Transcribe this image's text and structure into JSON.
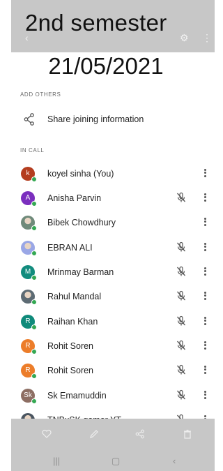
{
  "overlay": {
    "title": "2nd semester",
    "date": "21/05/2021"
  },
  "sections": {
    "add_others": "ADD OTHERS",
    "in_call": "IN CALL"
  },
  "share": {
    "label": "Share joining information"
  },
  "participants": [
    {
      "name": "koyel sinha (You)",
      "initial": "k",
      "color": "#b43d1f",
      "muted": false,
      "photo": false
    },
    {
      "name": "Anisha Parvin",
      "initial": "A",
      "color": "#7b2fbe",
      "muted": true,
      "photo": false
    },
    {
      "name": "Bibek Chowdhury",
      "initial": "",
      "color": "#6f8a7a",
      "muted": false,
      "photo": true
    },
    {
      "name": "EBRAN ALI",
      "initial": "",
      "color": "#9aa7e6",
      "muted": true,
      "photo": true
    },
    {
      "name": "Mrinmay Barman",
      "initial": "M",
      "color": "#128c7e",
      "muted": true,
      "photo": false
    },
    {
      "name": "Rahul Mandal",
      "initial": "",
      "color": "#5d6b74",
      "muted": true,
      "photo": true
    },
    {
      "name": "Raihan Khan",
      "initial": "R",
      "color": "#0f8a7a",
      "muted": true,
      "photo": false
    },
    {
      "name": "Rohit Soren",
      "initial": "R",
      "color": "#ec7d2a",
      "muted": true,
      "photo": false
    },
    {
      "name": "Rohit Soren",
      "initial": "R",
      "color": "#ec7d2a",
      "muted": true,
      "photo": false
    },
    {
      "name": "Sk Emamuddin",
      "initial": "Sk",
      "color": "#8d6e63",
      "muted": true,
      "photo": false
    },
    {
      "name": "TNBxSK gamer YT",
      "initial": "",
      "color": "#4a5560",
      "muted": true,
      "photo": true
    }
  ],
  "colors": {
    "bar": "#c7c7c7",
    "online": "#34a853",
    "icon": "#555555"
  }
}
